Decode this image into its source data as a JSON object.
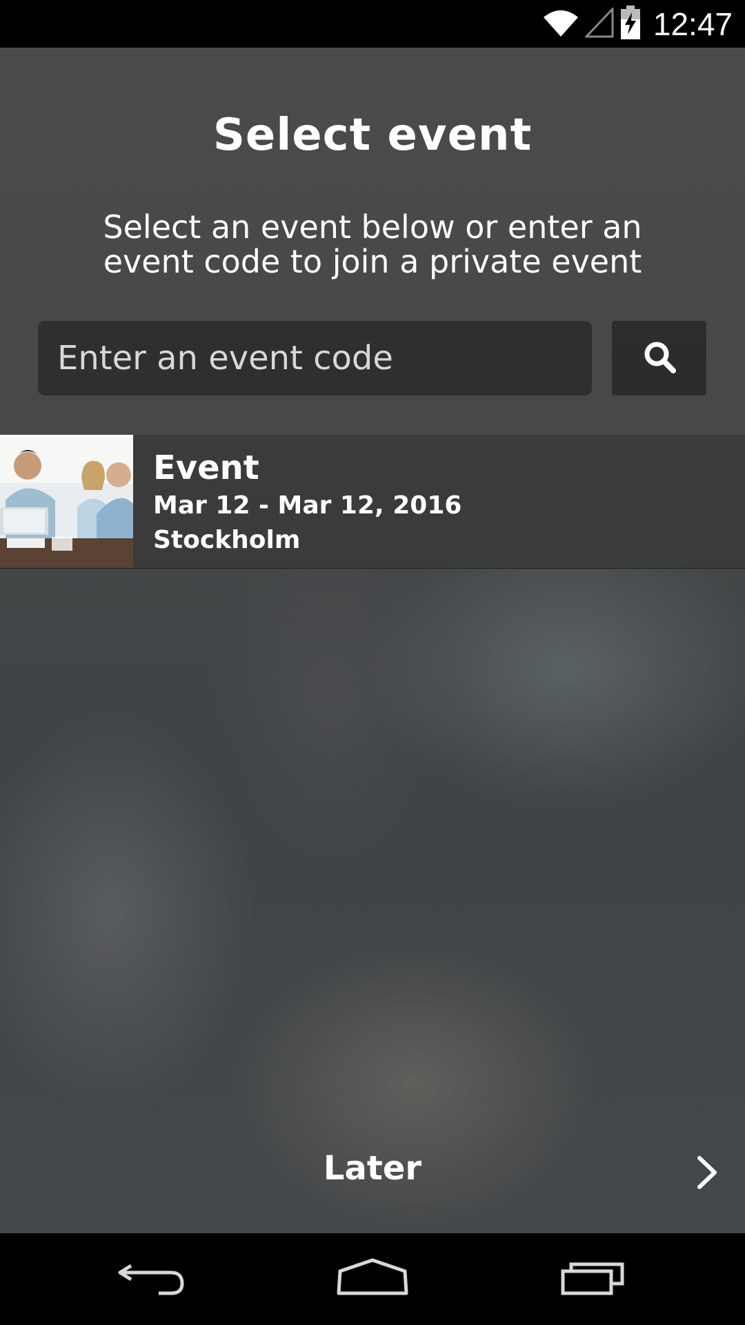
{
  "status_bar": {
    "time": "12:47",
    "icons": [
      "wifi-icon",
      "cell-signal-icon",
      "battery-charging-icon"
    ]
  },
  "header": {
    "title": "Select event",
    "subtitle": "Select an event below or enter an event code to join a private event"
  },
  "search": {
    "placeholder": "Enter an event code",
    "value": "",
    "button_icon": "search-icon"
  },
  "events": [
    {
      "name": "Event",
      "dates": "Mar 12 - Mar 12, 2016",
      "location": "Stockholm",
      "thumbnail": "people-meeting-photo"
    }
  ],
  "footer": {
    "later_label": "Later",
    "chevron_icon": "chevron-right-icon"
  },
  "nav_bar": {
    "icons": [
      "back-icon",
      "home-icon",
      "recent-apps-icon"
    ]
  }
}
